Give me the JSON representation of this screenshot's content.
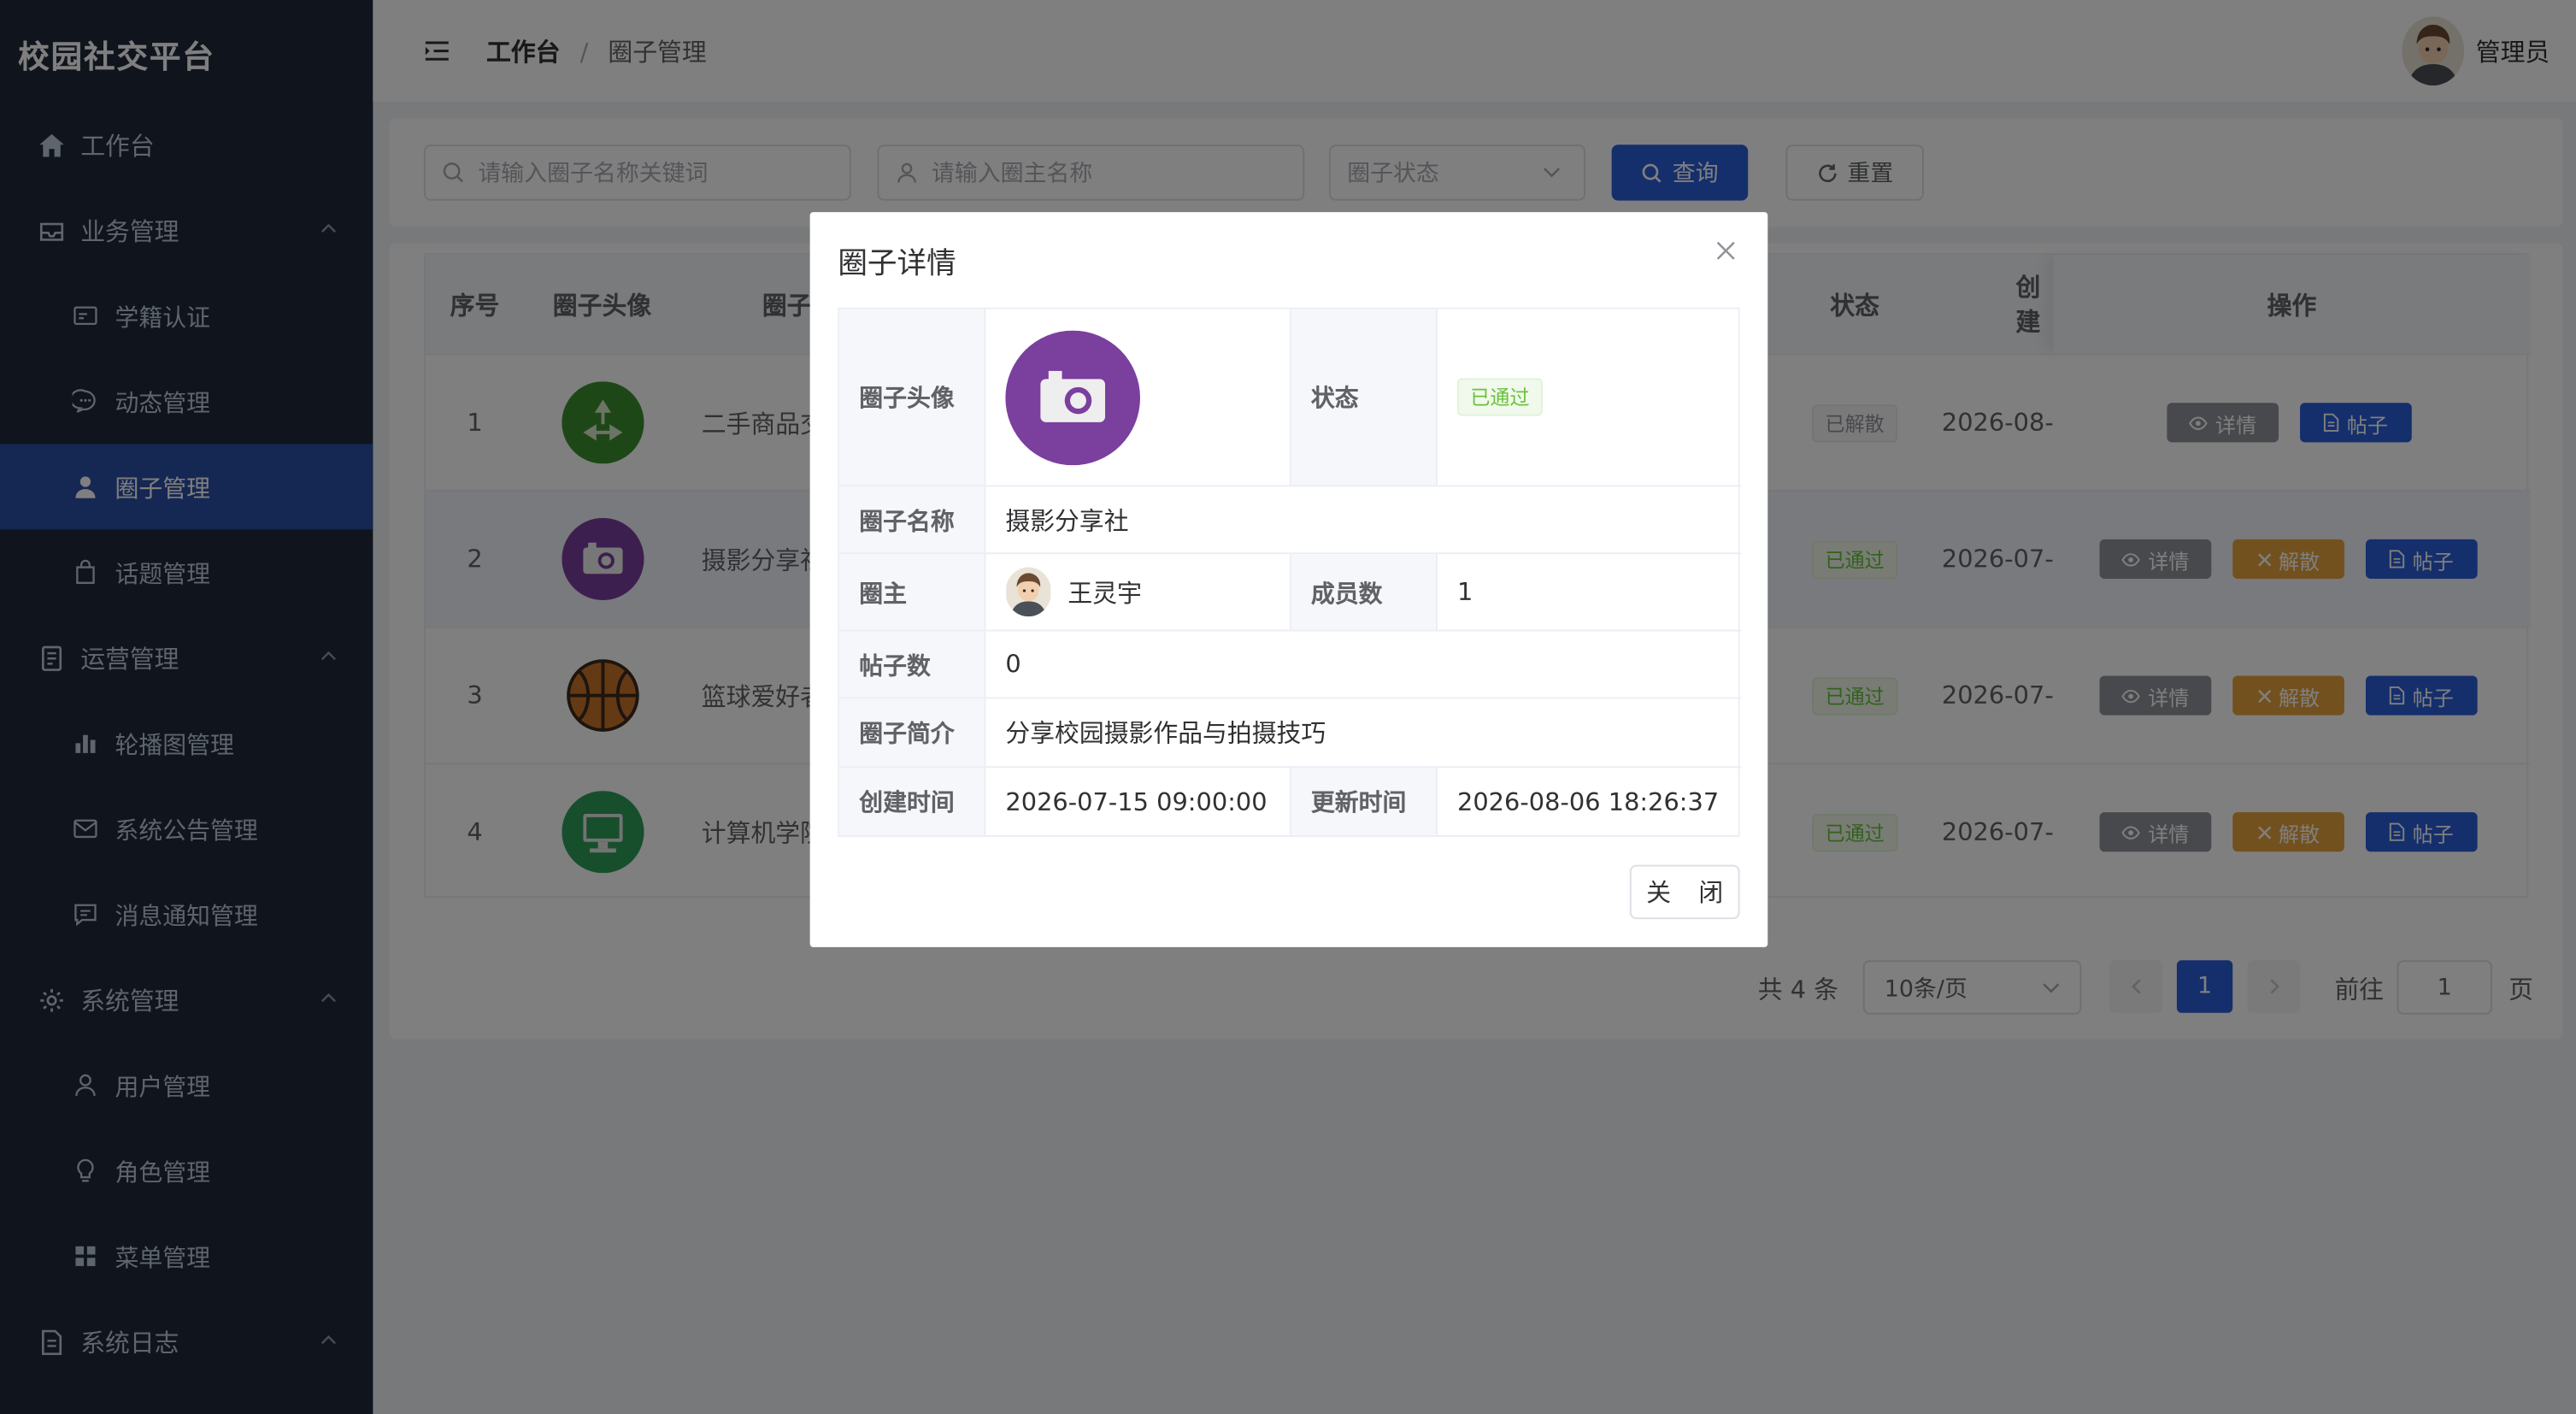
{
  "app": {
    "title": "校园社交平台"
  },
  "sidebar": {
    "items": [
      {
        "label": "工作台",
        "icon": "home-icon"
      },
      {
        "label": "业务管理",
        "icon": "inbox-icon"
      },
      {
        "label": "学籍认证",
        "icon": "id-card-icon"
      },
      {
        "label": "动态管理",
        "icon": "chat-bubble-icon"
      },
      {
        "label": "圈子管理",
        "icon": "user-icon"
      },
      {
        "label": "话题管理",
        "icon": "bag-icon"
      },
      {
        "label": "运营管理",
        "icon": "document-icon"
      },
      {
        "label": "轮播图管理",
        "icon": "bar-chart-icon"
      },
      {
        "label": "系统公告管理",
        "icon": "mail-icon"
      },
      {
        "label": "消息通知管理",
        "icon": "message-icon"
      },
      {
        "label": "系统管理",
        "icon": "gear-icon"
      },
      {
        "label": "用户管理",
        "icon": "user-outline-icon"
      },
      {
        "label": "角色管理",
        "icon": "bulb-icon"
      },
      {
        "label": "菜单管理",
        "icon": "grid-icon"
      },
      {
        "label": "系统日志",
        "icon": "log-document-icon"
      }
    ]
  },
  "header": {
    "breadcrumb": [
      "工作台",
      "/",
      "圈子管理"
    ],
    "user": "管理员"
  },
  "search": {
    "name_placeholder": "请输入圈子名称关键词",
    "owner_placeholder": "请输入圈主名称",
    "status_placeholder": "圈子状态",
    "query_label": "查询",
    "reset_label": "重置"
  },
  "table": {
    "headers": [
      "序号",
      "圈子头像",
      "圈子",
      "状态",
      "创建",
      "操作"
    ],
    "rows": [
      {
        "index": "1",
        "name": "二手商品交",
        "status": "已解散",
        "created": "2026-08-",
        "icon": "recycle-icon",
        "icon_color": "#3b8f2e"
      },
      {
        "index": "2",
        "name": "摄影分享社",
        "status": "已通过",
        "created": "2026-07-",
        "icon": "camera-icon",
        "icon_color": "#7b3f9e"
      },
      {
        "index": "3",
        "name": "篮球爱好者",
        "status": "已通过",
        "created": "2026-07-",
        "icon": "basketball-icon",
        "icon_color": "#c8742b"
      },
      {
        "index": "4",
        "name": "计算机学院",
        "status": "已通过",
        "created": "2026-07-",
        "icon": "computer-icon",
        "icon_color": "#2f9e5a"
      }
    ],
    "actions": {
      "detail": "详情",
      "dissolve": "解散",
      "posts": "帖子"
    }
  },
  "pagination": {
    "total": "共 4 条",
    "page_size": "10条/页",
    "current_page": "1",
    "goto_label": "前往",
    "goto_value": "1",
    "page_suffix": "页"
  },
  "dialog": {
    "title": "圈子详情",
    "avatar_label": "圈子头像",
    "status_label": "状态",
    "status_value": "已通过",
    "name_label": "圈子名称",
    "name_value": "摄影分享社",
    "owner_label": "圈主",
    "owner_value": "王灵宇",
    "members_label": "成员数",
    "members_value": "1",
    "posts_label": "帖子数",
    "posts_value": "0",
    "intro_label": "圈子简介",
    "intro_value": "分享校园摄影作品与拍摄技巧",
    "created_label": "创建时间",
    "created_value": "2026-07-15 09:00:00",
    "updated_label": "更新时间",
    "updated_value": "2026-08-06 18:26:37",
    "close_label": "关 闭"
  },
  "colors": {
    "sidebar_bg": "#1e283b",
    "sidebar_active": "#2b4ea7",
    "primary": "#2b5fd9",
    "success": "#67c23a",
    "warning": "#e6a23c",
    "info": "#909399"
  }
}
